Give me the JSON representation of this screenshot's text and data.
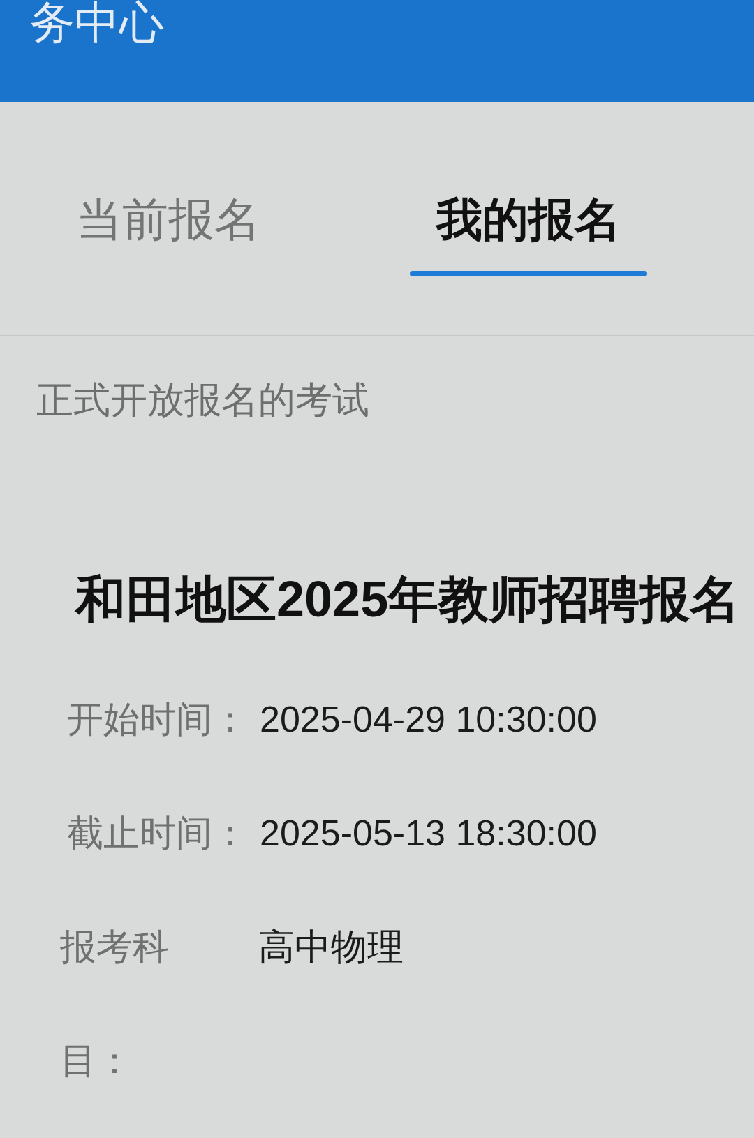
{
  "header": {
    "title": "务中心"
  },
  "tabs": [
    {
      "label": "当前报名",
      "selected": false
    },
    {
      "label": "我的报名",
      "selected": true
    }
  ],
  "section": {
    "title": "正式开放报名的考试"
  },
  "exam": {
    "title": "和田地区2025年教师招聘报名",
    "fields": [
      {
        "kind": "inline",
        "label": "开始时间：",
        "value": "2025-04-29 10:30:00"
      },
      {
        "kind": "inline",
        "label": "截止时间：",
        "value": "2025-05-13 18:30:00"
      },
      {
        "kind": "columns",
        "label": "报考科目：",
        "value": "高中物理"
      }
    ]
  }
}
